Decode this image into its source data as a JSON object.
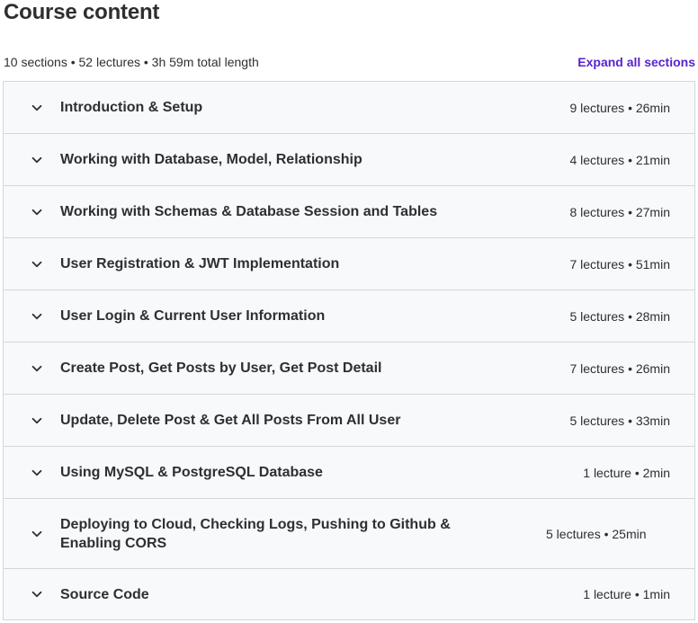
{
  "header": {
    "title": "Course content",
    "summary": "10 sections • 52 lectures • 3h 59m total length",
    "expand_label": "Expand all sections"
  },
  "icons": {
    "section_toggle": "chevron-down-icon"
  },
  "colors": {
    "link": "#5624d0",
    "section_bg": "#f7f9fa",
    "border": "#d1d7dc",
    "text": "#2d2f31"
  },
  "sections": [
    {
      "title": "Introduction & Setup",
      "meta": "9 lectures • 26min"
    },
    {
      "title": "Working with Database, Model, Relationship",
      "meta": "4 lectures • 21min"
    },
    {
      "title": "Working with Schemas & Database Session and Tables",
      "meta": "8 lectures • 27min"
    },
    {
      "title": "User Registration & JWT Implementation",
      "meta": "7 lectures • 51min"
    },
    {
      "title": "User Login & Current User Information",
      "meta": "5 lectures • 28min"
    },
    {
      "title": "Create Post, Get Posts by User, Get Post Detail",
      "meta": "7 lectures • 26min"
    },
    {
      "title": "Update, Delete Post & Get All Posts From All User",
      "meta": "5 lectures • 33min"
    },
    {
      "title": "Using MySQL & PostgreSQL Database",
      "meta": "1 lecture • 2min"
    },
    {
      "title": "Deploying to Cloud, Checking Logs, Pushing to Github & Enabling CORS",
      "meta": "5 lectures • 25min"
    },
    {
      "title": "Source Code",
      "meta": "1 lecture • 1min"
    }
  ]
}
